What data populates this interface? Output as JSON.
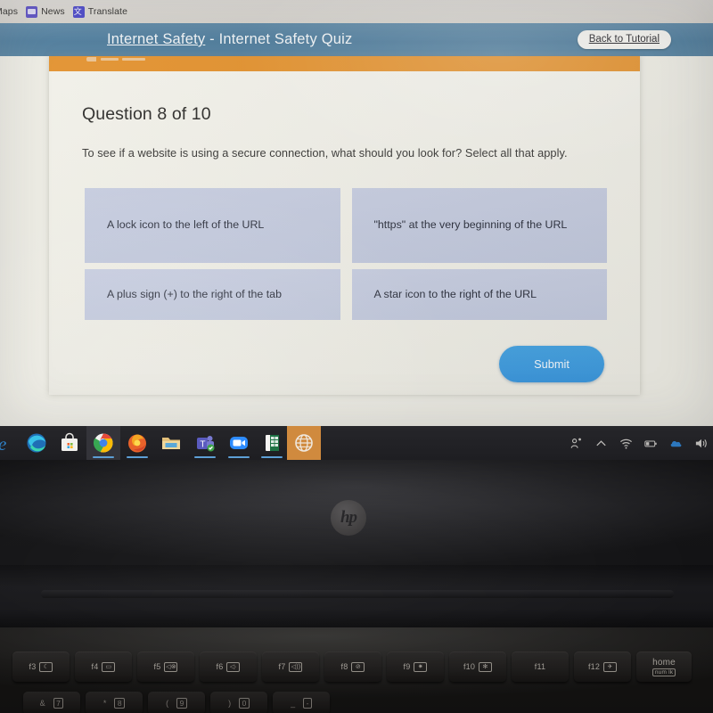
{
  "browser": {
    "bookmarks": [
      {
        "label": "Maps",
        "icon": null
      },
      {
        "label": "News",
        "icon": "news-icon"
      },
      {
        "label": "Translate",
        "icon": "translate-icon"
      }
    ]
  },
  "quiz_header": {
    "breadcrumb": "Internet Safety",
    "separator": " - ",
    "page_title": "Internet Safety Quiz",
    "back_button_label": "Back to Tutorial",
    "bar_color": "#4e7c9c",
    "accent_color": "#e3922f"
  },
  "quiz": {
    "question_number_label": "Question 8 of 10",
    "current_question": 8,
    "total_questions": 10,
    "prompt": "To see if a website is using a secure connection, what should you look for? Select all that apply.",
    "options": [
      {
        "id": "opt-1",
        "label": "A lock icon to the left of the URL",
        "selected": false
      },
      {
        "id": "opt-2",
        "label": "\"https\" at the very beginning of the URL",
        "selected": false
      },
      {
        "id": "opt-3",
        "label": "A plus sign (+) to the right of the tab",
        "selected": false
      },
      {
        "id": "opt-4",
        "label": "A star icon to the right of the URL",
        "selected": false
      }
    ],
    "option_color": "#c4cade",
    "submit_label": "Submit",
    "submit_color": "#3b96dc"
  },
  "taskbar": {
    "apps": [
      {
        "name": "internet-explorer",
        "label": "Internet Explorer",
        "state": "idle"
      },
      {
        "name": "microsoft-edge",
        "label": "Microsoft Edge",
        "state": "idle"
      },
      {
        "name": "microsoft-store",
        "label": "Microsoft Store",
        "state": "idle"
      },
      {
        "name": "google-chrome",
        "label": "Google Chrome",
        "state": "open"
      },
      {
        "name": "mozilla-firefox",
        "label": "Mozilla Firefox",
        "state": "open"
      },
      {
        "name": "file-explorer",
        "label": "File Explorer",
        "state": "idle"
      },
      {
        "name": "microsoft-teams",
        "label": "Microsoft Teams",
        "state": "open"
      },
      {
        "name": "zoom",
        "label": "Zoom",
        "state": "open"
      },
      {
        "name": "microsoft-excel",
        "label": "Microsoft Excel",
        "state": "open"
      },
      {
        "name": "globe-app",
        "label": "Browser",
        "state": "active"
      }
    ],
    "tray": [
      {
        "name": "people-share-icon",
        "label": "Meet Now"
      },
      {
        "name": "chevron-up-icon",
        "label": "Show hidden icons"
      },
      {
        "name": "wifi-icon",
        "label": "Network"
      },
      {
        "name": "battery-icon",
        "label": "Battery"
      },
      {
        "name": "onedrive-cloud-icon",
        "label": "OneDrive"
      },
      {
        "name": "volume-icon",
        "label": "Volume"
      }
    ]
  },
  "laptop": {
    "brand": "hp",
    "function_keys": [
      {
        "label": "f3",
        "icon": "moon"
      },
      {
        "label": "f4",
        "icon": "display"
      },
      {
        "label": "f5",
        "icon": "mute"
      },
      {
        "label": "f6",
        "icon": "volume-down"
      },
      {
        "label": "f7",
        "icon": "volume-up"
      },
      {
        "label": "f8",
        "icon": "mic-mute"
      },
      {
        "label": "f9",
        "icon": "brightness-down"
      },
      {
        "label": "f10",
        "icon": "brightness-up"
      },
      {
        "label": "f11",
        "icon": ""
      },
      {
        "label": "f12",
        "icon": "airplane"
      }
    ],
    "home_key": {
      "label": "home",
      "sub_label": "num lk"
    },
    "number_keys": [
      {
        "shift": "&",
        "num": "7"
      },
      {
        "shift": "*",
        "num": "8"
      },
      {
        "shift": "(",
        "num": "9"
      },
      {
        "shift": ")",
        "num": "0"
      },
      {
        "shift": "_",
        "num": "-"
      }
    ]
  }
}
